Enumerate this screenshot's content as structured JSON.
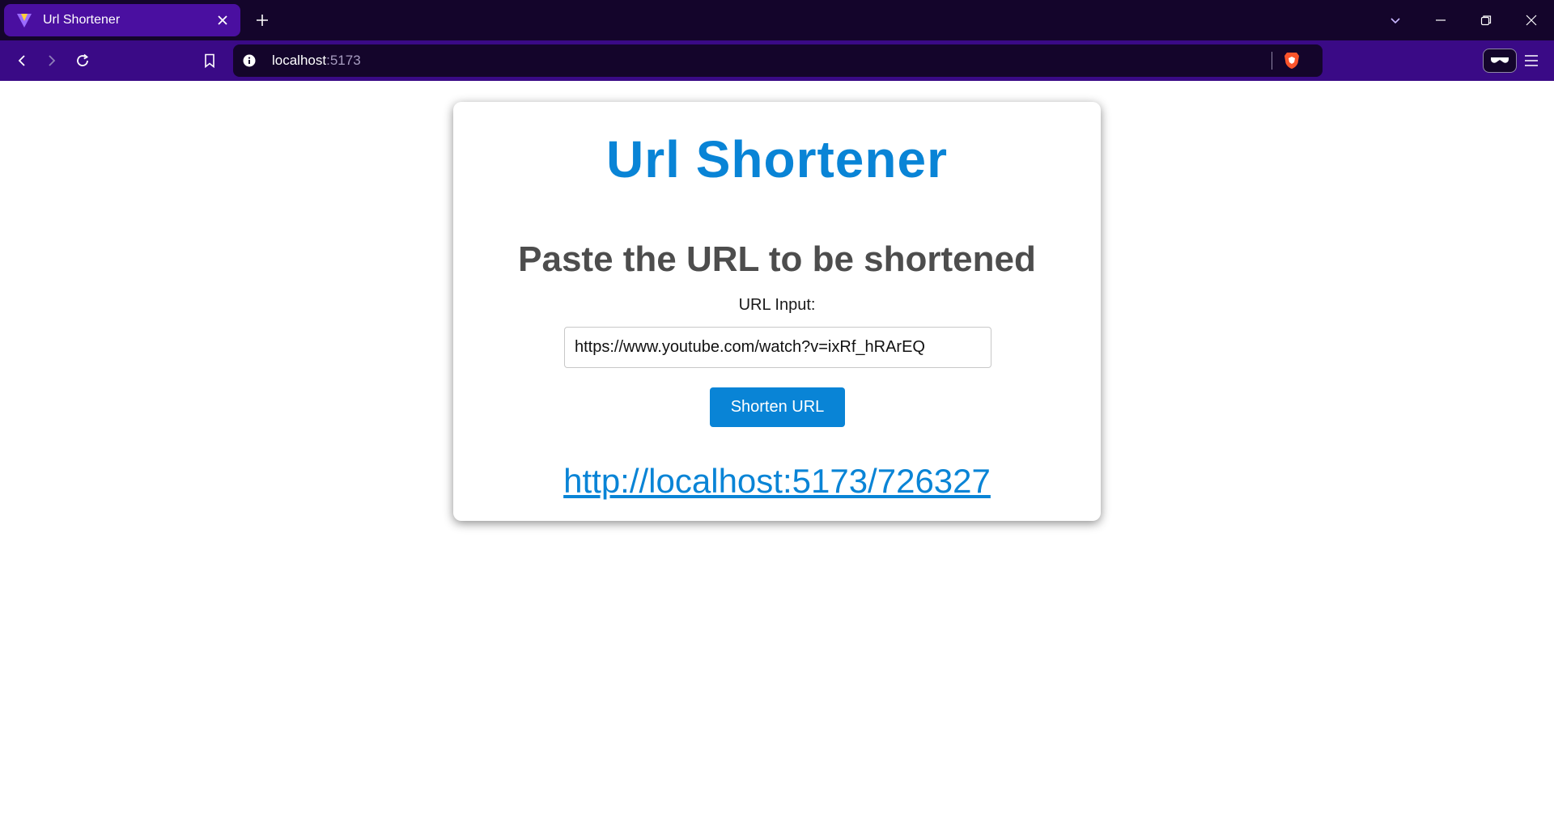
{
  "browser": {
    "tab_title": "Url Shortener",
    "address_host": "localhost",
    "address_port": ":5173",
    "icons": {
      "favicon": "vite-logo-icon",
      "tab_close": "close-icon",
      "new_tab": "plus-icon",
      "tab_list": "chevron-down-icon",
      "minimize": "minimize-icon",
      "restore": "restore-icon",
      "close_window": "close-icon",
      "back": "back-arrow-icon",
      "forward": "forward-arrow-icon",
      "reload": "reload-icon",
      "bookmark": "bookmark-icon",
      "site_info": "info-icon",
      "shields": "brave-lion-icon",
      "sidebar": "sidebar-icon",
      "wallet": "glasses-icon",
      "menu": "hamburger-menu-icon"
    },
    "colors": {
      "titlebar": "#14052b",
      "active_tab": "#4a0fa0",
      "toolbar": "#3a0a86"
    }
  },
  "app": {
    "title": "Url Shortener",
    "subtitle": "Paste the URL to be shortened",
    "input_label": "URL Input:",
    "input_value": "https://www.youtube.com/watch?v=ixRf_hRArEQ",
    "button_label": "Shorten URL",
    "short_url": "http://localhost:5173/726327",
    "colors": {
      "accent": "#0984d6",
      "subtitle": "#4d4d4d"
    }
  }
}
